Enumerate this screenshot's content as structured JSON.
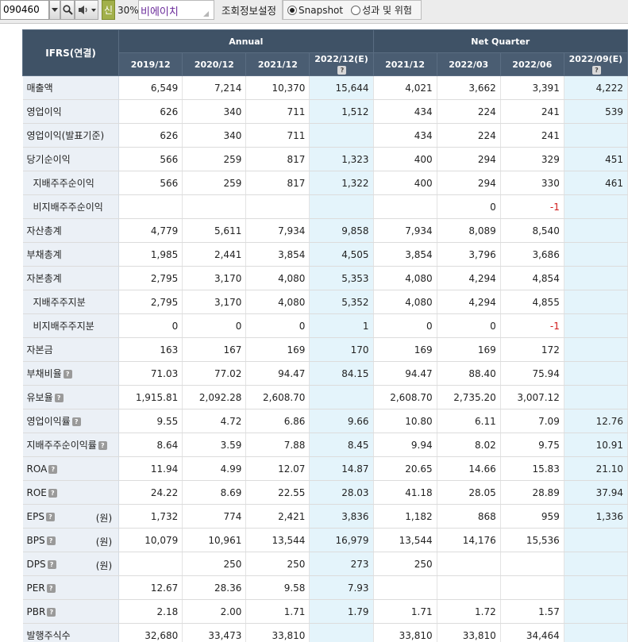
{
  "toolbar": {
    "stock_code": "090460",
    "sin_label": "신",
    "percent": "30%",
    "company_name": "비에이치",
    "setting_label": "조회정보설정",
    "radio_options": [
      "Snapshot",
      "성과 및 위험"
    ],
    "radio_selected": "Snapshot"
  },
  "table": {
    "corner_header": "IFRS(연결)",
    "group_headers": [
      "Annual",
      "Net Quarter"
    ],
    "periods": [
      "2019/12",
      "2020/12",
      "2021/12",
      "2022/12(E)",
      "2021/12",
      "2022/03",
      "2022/06",
      "2022/09(E)"
    ],
    "rows": [
      {
        "label": "매출액",
        "values": [
          "6,549",
          "7,214",
          "10,370",
          "15,644",
          "4,021",
          "3,662",
          "3,391",
          "4,222"
        ]
      },
      {
        "label": "영업이익",
        "values": [
          "626",
          "340",
          "711",
          "1,512",
          "434",
          "224",
          "241",
          "539"
        ]
      },
      {
        "label": "영업이익(발표기준)",
        "values": [
          "626",
          "340",
          "711",
          "",
          "434",
          "224",
          "241",
          ""
        ]
      },
      {
        "label": "당기순이익",
        "values": [
          "566",
          "259",
          "817",
          "1,323",
          "400",
          "294",
          "329",
          "451"
        ]
      },
      {
        "label": "지배주주순이익",
        "values": [
          "566",
          "259",
          "817",
          "1,322",
          "400",
          "294",
          "330",
          "461"
        ]
      },
      {
        "label": "비지배주주순이익",
        "values": [
          "",
          "",
          "",
          "",
          "",
          "0",
          "-1",
          ""
        ]
      },
      {
        "label": "자산총계",
        "values": [
          "4,779",
          "5,611",
          "7,934",
          "9,858",
          "7,934",
          "8,089",
          "8,540",
          ""
        ]
      },
      {
        "label": "부채총계",
        "values": [
          "1,985",
          "2,441",
          "3,854",
          "4,505",
          "3,854",
          "3,796",
          "3,686",
          ""
        ]
      },
      {
        "label": "자본총계",
        "values": [
          "2,795",
          "3,170",
          "4,080",
          "5,353",
          "4,080",
          "4,294",
          "4,854",
          ""
        ]
      },
      {
        "label": "지배주주지분",
        "values": [
          "2,795",
          "3,170",
          "4,080",
          "5,352",
          "4,080",
          "4,294",
          "4,855",
          ""
        ]
      },
      {
        "label": "비지배주주지분",
        "values": [
          "0",
          "0",
          "0",
          "1",
          "0",
          "0",
          "-1",
          ""
        ]
      },
      {
        "label": "자본금",
        "values": [
          "163",
          "167",
          "169",
          "170",
          "169",
          "169",
          "172",
          ""
        ]
      },
      {
        "label": "부채비율",
        "values": [
          "71.03",
          "77.02",
          "94.47",
          "84.15",
          "94.47",
          "88.40",
          "75.94",
          ""
        ]
      },
      {
        "label": "유보율",
        "values": [
          "1,915.81",
          "2,092.28",
          "2,608.70",
          "",
          "2,608.70",
          "2,735.20",
          "3,007.12",
          ""
        ]
      },
      {
        "label": "영업이익률",
        "values": [
          "9.55",
          "4.72",
          "6.86",
          "9.66",
          "10.80",
          "6.11",
          "7.09",
          "12.76"
        ]
      },
      {
        "label": "지배주주순이익률",
        "values": [
          "8.64",
          "3.59",
          "7.88",
          "8.45",
          "9.94",
          "8.02",
          "9.75",
          "10.91"
        ]
      },
      {
        "label": "ROA",
        "values": [
          "11.94",
          "4.99",
          "12.07",
          "14.87",
          "20.65",
          "14.66",
          "15.83",
          "21.10"
        ]
      },
      {
        "label": "ROE",
        "values": [
          "24.22",
          "8.69",
          "22.55",
          "28.03",
          "41.18",
          "28.05",
          "28.89",
          "37.94"
        ]
      },
      {
        "label": "EPS",
        "unit": "(원)",
        "values": [
          "1,732",
          "774",
          "2,421",
          "3,836",
          "1,182",
          "868",
          "959",
          "1,336"
        ]
      },
      {
        "label": "BPS",
        "unit": "(원)",
        "values": [
          "10,079",
          "10,961",
          "13,544",
          "16,979",
          "13,544",
          "14,176",
          "15,536",
          ""
        ]
      },
      {
        "label": "DPS",
        "unit": "(원)",
        "values": [
          "",
          "250",
          "250",
          "273",
          "250",
          "",
          "",
          ""
        ]
      },
      {
        "label": "PER",
        "values": [
          "12.67",
          "28.36",
          "9.58",
          "7.93",
          "",
          "",
          "",
          ""
        ]
      },
      {
        "label": "PBR",
        "values": [
          "2.18",
          "2.00",
          "1.71",
          "1.79",
          "1.71",
          "1.72",
          "1.57",
          ""
        ]
      },
      {
        "label": "발행주식수",
        "values": [
          "32,680",
          "33,473",
          "33,810",
          "",
          "33,810",
          "33,810",
          "34,464",
          ""
        ]
      }
    ]
  }
}
